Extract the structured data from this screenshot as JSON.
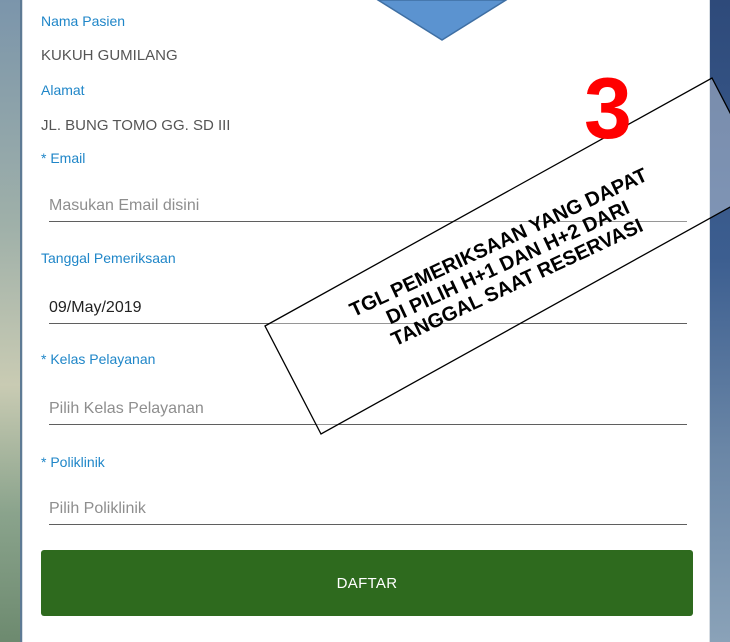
{
  "form": {
    "nama_pasien_label": "Nama Pasien",
    "nama_pasien_value": "KUKUH GUMILANG",
    "alamat_label": "Alamat",
    "alamat_value": "JL. BUNG TOMO GG. SD III",
    "email_label": "* Email",
    "email_placeholder": "Masukan Email disini",
    "tanggal_label": "Tanggal Pemeriksaan",
    "tanggal_value": "09/May/2019",
    "kelas_label": "* Kelas Pelayanan",
    "kelas_placeholder": "Pilih Kelas Pelayanan",
    "poliklinik_label": "* Poliklinik",
    "poliklinik_placeholder": "Pilih Poliklinik",
    "submit_label": "DAFTAR"
  },
  "annotation": {
    "step_number": "3",
    "note_lines": [
      "TGL PEMERIKSAAN YANG DAPAT",
      "DI PILIH H+1 DAN H+2 DARI",
      "TANGGAL SAAT RESERVASI"
    ]
  },
  "colors": {
    "label": "#1f86c8",
    "button": "#2e6a1e",
    "callout": "#5b93d0",
    "step_number": "#ff0000"
  }
}
